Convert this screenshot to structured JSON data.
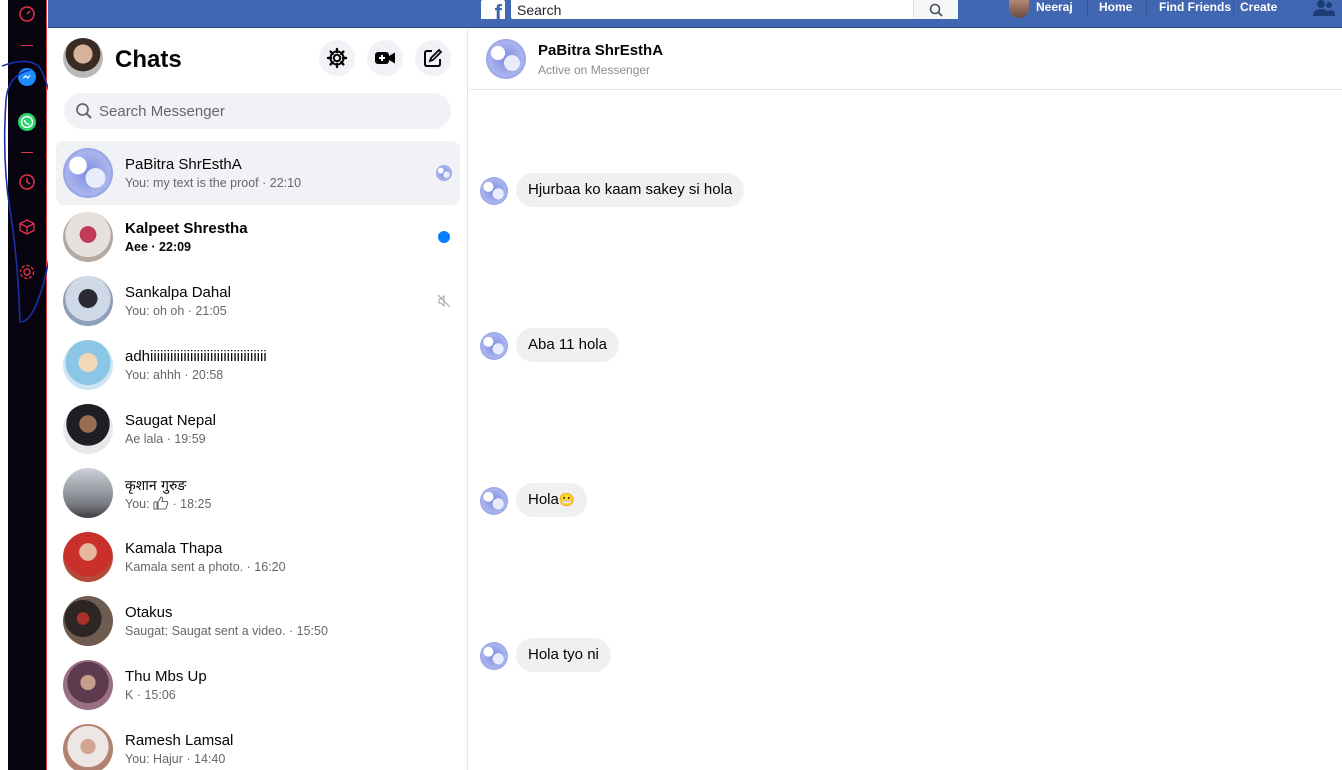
{
  "topbar": {
    "logo": "f",
    "search_placeholder": "Search",
    "user_name": "Neeraj",
    "nav": [
      "Home",
      "Find Friends",
      "Create"
    ]
  },
  "chats": {
    "title": "Chats",
    "search_placeholder": "Search Messenger",
    "items": [
      {
        "name": "PaBitra ShrEsthA",
        "subtitle": "You: my text is the proof · 22:10",
        "status": "seen",
        "active": true
      },
      {
        "name": "Kalpeet Shrestha",
        "subtitle": "Aee · 22:09",
        "status": "unread"
      },
      {
        "name": "Sankalpa Dahal",
        "subtitle": "You: oh oh · 21:05",
        "status": "muted"
      },
      {
        "name": "adhiiiiiiiiiiiiiiiiiiiiiiiiiiiiiiiiiii",
        "subtitle": "You: ahhh · 20:58"
      },
      {
        "name": "Saugat Nepal",
        "subtitle": "Ae lala · 19:59"
      },
      {
        "name": "कृशान गुरुङ",
        "subtitle_prefix": "You:",
        "subtitle_suffix": "· 18:25"
      },
      {
        "name": "Kamala Thapa",
        "subtitle": "Kamala sent a photo. · 16:20"
      },
      {
        "name": "Otakus",
        "subtitle": "Saugat: Saugat sent a video. · 15:50"
      },
      {
        "name": "Thu Mbs Up",
        "subtitle": "K · 15:06"
      },
      {
        "name": "Ramesh Lamsal",
        "subtitle": "You: Hajur · 14:40"
      }
    ]
  },
  "conversation": {
    "name": "PaBitra ShrEsthA",
    "status": "Active on Messenger",
    "messages": [
      {
        "text": "Hjurbaa ko kaam sakey si hola"
      },
      {
        "text": "Aba 11 hola"
      },
      {
        "text": "Hola",
        "emoji": "😬"
      },
      {
        "text": "Hola tyo ni"
      }
    ]
  },
  "colors": {
    "fb_blue": "#4267b2",
    "messenger_blue": "#0a7cff",
    "rail_bg": "#07040f",
    "rail_icon_red": "#e0324a"
  }
}
